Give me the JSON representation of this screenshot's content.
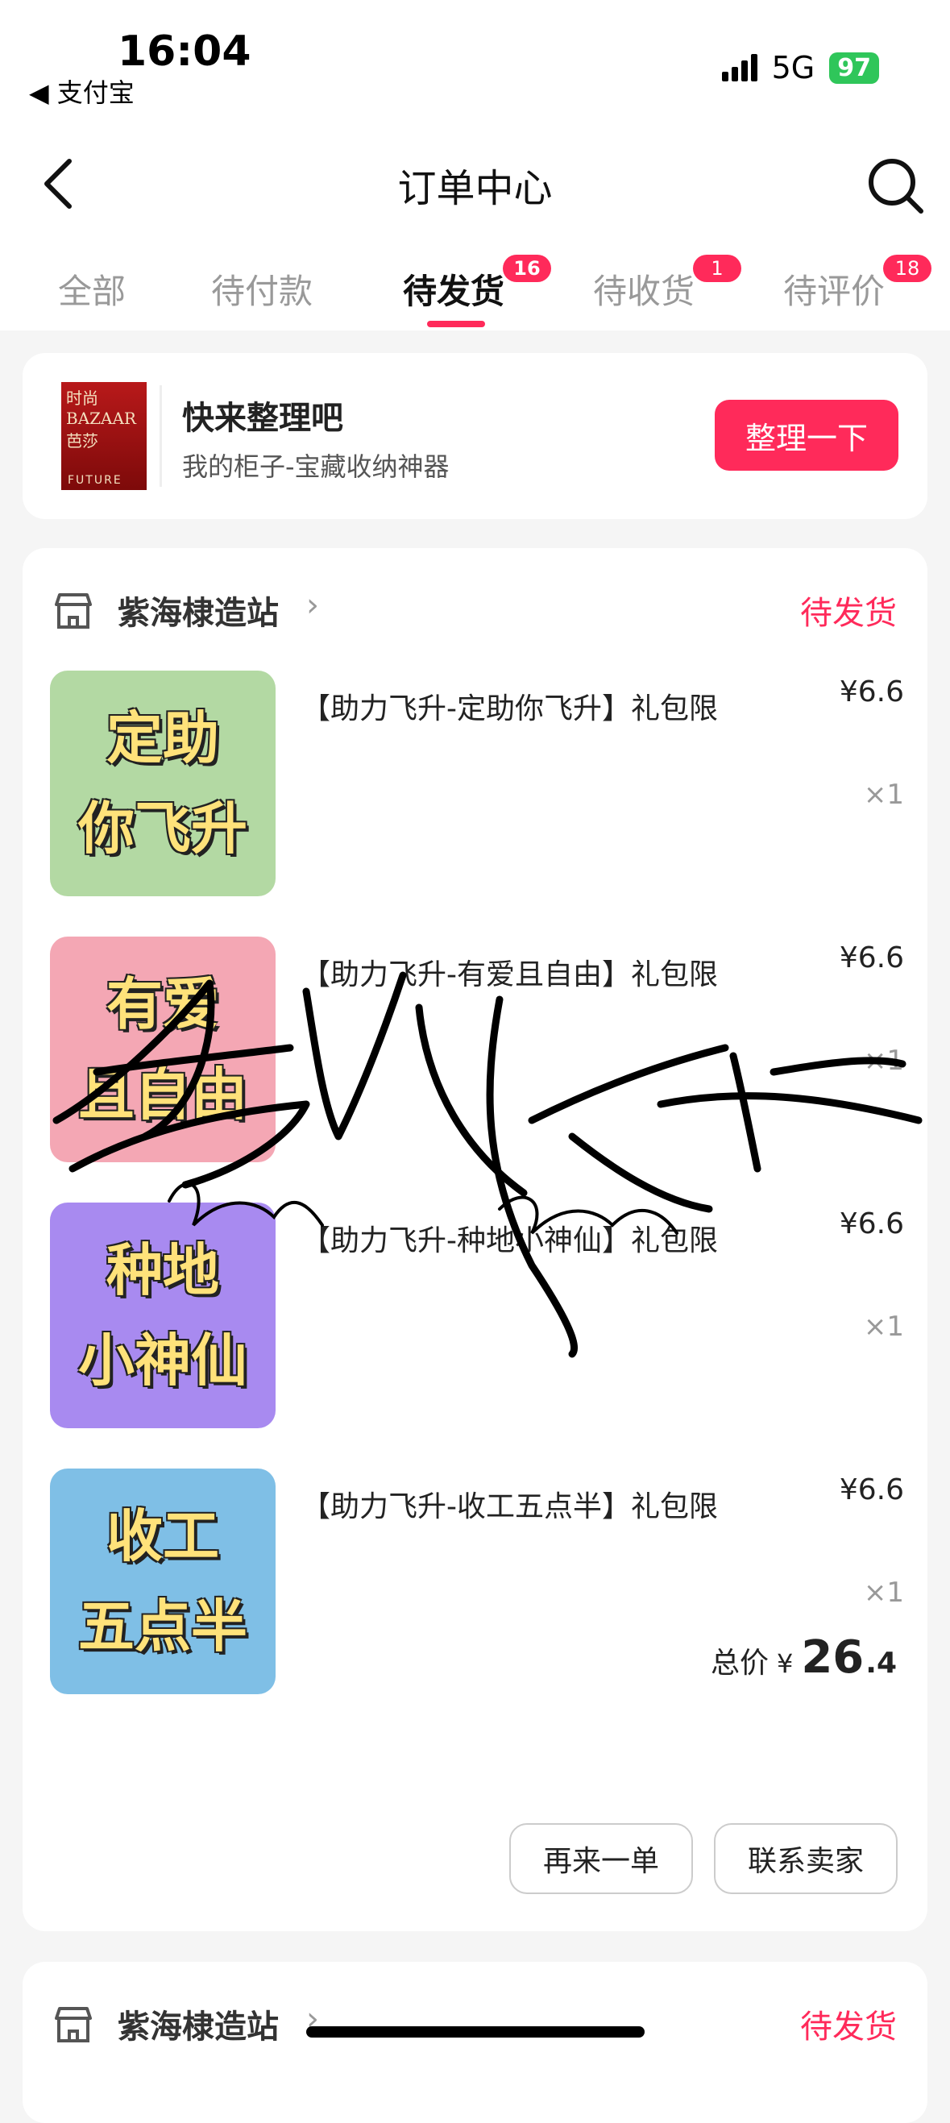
{
  "status_bar": {
    "time": "16:04",
    "back_app": "◀ 支付宝",
    "network": "5G",
    "battery": "97"
  },
  "header": {
    "title": "订单中心"
  },
  "tabs": [
    {
      "label": "全部",
      "badge": ""
    },
    {
      "label": "待付款",
      "badge": ""
    },
    {
      "label": "待发货",
      "badge": "16"
    },
    {
      "label": "待收货",
      "badge": "1"
    },
    {
      "label": "待评价",
      "badge": "18"
    }
  ],
  "promo": {
    "image_text_top": "时尚BAZAAR 芭莎",
    "image_text_bottom": "FUTURE",
    "title": "快来整理吧",
    "subtitle": "我的柜子-宝藏收纳神器",
    "button": "整理一下"
  },
  "order": {
    "shop": "紫海棣造站",
    "status": "待发货",
    "items": [
      {
        "thumb_lines": [
          "定助",
          "你飞升"
        ],
        "thumb_color": "#b3d9a3",
        "title": "【助力飞升-定助你飞升】礼包限",
        "price": "¥6.6",
        "qty": "×1"
      },
      {
        "thumb_lines": [
          "有爱",
          "且自由"
        ],
        "thumb_color": "#f4a7b4",
        "title": "【助力飞升-有爱且自由】礼包限",
        "price": "¥6.6",
        "qty": "×1"
      },
      {
        "thumb_lines": [
          "种地",
          "小神仙"
        ],
        "thumb_color": "#a88af0",
        "title": "【助力飞升-种地小神仙】礼包限",
        "price": "¥6.6",
        "qty": "×1"
      },
      {
        "thumb_lines": [
          "收工",
          "五点半"
        ],
        "thumb_color": "#7fbfe6",
        "title": "【助力飞升-收工五点半】礼包限",
        "price": "¥6.6",
        "qty": "×1"
      }
    ],
    "total_label": "总价",
    "currency": "¥",
    "total_int": "26",
    "total_dec": ".4",
    "buttons": {
      "reorder": "再来一单",
      "contact": "联系卖家"
    }
  },
  "order2": {
    "shop": "紫海棣造站",
    "status": "待发货"
  },
  "colors": {
    "accent": "#ff2a5a",
    "battery": "#2fc65a"
  }
}
